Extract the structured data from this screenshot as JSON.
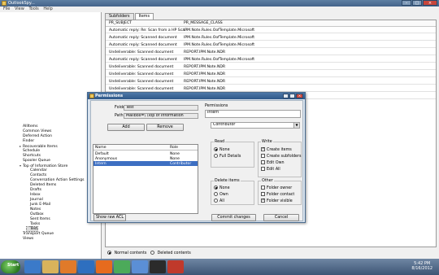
{
  "window": {
    "title": "OutlookSpy...",
    "menu": [
      "File",
      "View",
      "Tools",
      "Help"
    ]
  },
  "tree": {
    "items": [
      {
        "label": "AllItems",
        "indent": 0,
        "expander": "",
        "selected": false
      },
      {
        "label": "Common Views",
        "indent": 0,
        "expander": "",
        "selected": false
      },
      {
        "label": "Deferred Action",
        "indent": 0,
        "expander": "",
        "selected": false
      },
      {
        "label": "Finder",
        "indent": 0,
        "expander": "",
        "selected": false
      },
      {
        "label": "Recoverable Items",
        "indent": 0,
        "expander": "▸",
        "selected": false
      },
      {
        "label": "Schedule",
        "indent": 0,
        "expander": "",
        "selected": false
      },
      {
        "label": "Shortcuts",
        "indent": 0,
        "expander": "",
        "selected": false
      },
      {
        "label": "Spooler Queue",
        "indent": 0,
        "expander": "",
        "selected": false
      },
      {
        "label": "Top of Information Store",
        "indent": 0,
        "expander": "▾",
        "selected": false
      },
      {
        "label": "Calendar",
        "indent": 1,
        "expander": "",
        "selected": false
      },
      {
        "label": "Contacts",
        "indent": 1,
        "expander": "",
        "selected": false
      },
      {
        "label": "Conversation Action Settings",
        "indent": 1,
        "expander": "",
        "selected": false
      },
      {
        "label": "Deleted Items",
        "indent": 1,
        "expander": "",
        "selected": false
      },
      {
        "label": "Drafts",
        "indent": 1,
        "expander": "",
        "selected": false
      },
      {
        "label": "Inbox",
        "indent": 1,
        "expander": "",
        "selected": false
      },
      {
        "label": "Journal",
        "indent": 1,
        "expander": "",
        "selected": false
      },
      {
        "label": "Junk E-Mail",
        "indent": 1,
        "expander": "",
        "selected": false
      },
      {
        "label": "Notes",
        "indent": 1,
        "expander": "",
        "selected": false
      },
      {
        "label": "Outbox",
        "indent": 1,
        "expander": "",
        "selected": false
      },
      {
        "label": "Sent Items",
        "indent": 1,
        "expander": "",
        "selected": false
      },
      {
        "label": "Tasks",
        "indent": 1,
        "expander": "",
        "selected": false
      },
      {
        "label": "Test",
        "indent": 1,
        "expander": "",
        "selected": true
      },
      {
        "label": "Transport Queue",
        "indent": 0,
        "expander": "",
        "selected": false
      },
      {
        "label": "Views",
        "indent": 0,
        "expander": "",
        "selected": false
      }
    ]
  },
  "right": {
    "tabs": [
      {
        "label": "Subfolders",
        "active": false
      },
      {
        "label": "Items",
        "active": true
      }
    ],
    "columns": [
      "PR_SUBJECT",
      "PR_MESSAGE_CLASS"
    ],
    "rows": [
      [
        "Automatic reply: Re: Scan from a HP Sca...",
        "IPM.Note.Rules.OofTemplate.Microsoft"
      ],
      [
        "Automatic reply: Scanned document",
        "IPM.Note.Rules.OofTemplate.Microsoft"
      ],
      [
        "Automatic reply: Scanned document",
        "IPM.Note.Rules.OofTemplate.Microsoft"
      ],
      [
        "Undeliverable: Scanned document",
        "REPORT.IPM.Note.NDR"
      ],
      [
        "Automatic reply: Scanned document",
        "IPM.Note.Rules.OofTemplate.Microsoft"
      ],
      [
        "Undeliverable: Scanned document",
        "REPORT.IPM.Note.NDR"
      ],
      [
        "Undeliverable: Scanned document",
        "REPORT.IPM.Note.NDR"
      ],
      [
        "Undeliverable: Scanned document",
        "REPORT.IPM.Note.NDR"
      ],
      [
        "Undeliverable: Scanned document",
        "REPORT.IPM.Note.NDR"
      ],
      [
        "Undeliverable: Scanned document",
        "REPORT.IPM.Note.NDR"
      ]
    ],
    "contents": {
      "normal": "Normal contents",
      "deleted": "Deleted contents",
      "selected": "normal"
    }
  },
  "dialog": {
    "title": "Permissions",
    "folder_name_label": "Folder name:",
    "folder_name_value": "Test",
    "path_label": "Path:",
    "path_value": "Mailbox=\\                  \\Top of Information",
    "add_label": "Add",
    "remove_label": "Remove",
    "list_columns": [
      "Name",
      "Role"
    ],
    "list_rows": [
      {
        "name": "Default",
        "role": "None",
        "selected": false
      },
      {
        "name": "Anonymous",
        "role": "None",
        "selected": false
      },
      {
        "name": "Intern",
        "role": "Contributor",
        "selected": true
      }
    ],
    "show_raw_acl_label": "Show raw ACL",
    "permissions_label": "Permissions",
    "permissions_user": "Intern",
    "role_value": "Contributor",
    "read": {
      "title": "Read",
      "options": [
        "None",
        "Full Details"
      ],
      "selected": 0
    },
    "write": {
      "title": "Write",
      "options": [
        {
          "label": "Create items",
          "checked": true
        },
        {
          "label": "Create subfolders",
          "checked": false
        },
        {
          "label": "Edit Own",
          "checked": false
        },
        {
          "label": "Edit All",
          "checked": false
        }
      ]
    },
    "delete": {
      "title": "Delete items",
      "options": [
        "None",
        "Own",
        "All"
      ],
      "selected": 0
    },
    "other": {
      "title": "Other",
      "options": [
        {
          "label": "Folder owner",
          "checked": false
        },
        {
          "label": "Folder contact",
          "checked": false
        },
        {
          "label": "Folder visible",
          "checked": true
        }
      ]
    },
    "commit_label": "Commit changes",
    "cancel_label": "Cancel"
  },
  "taskbar": {
    "start_label": "Start",
    "time": "5:42 PM",
    "date": "8/16/2012",
    "icons": [
      "ie-icon",
      "explorer-icon",
      "media-icon",
      "outlook-icon",
      "firefox-icon",
      "chrome-icon",
      "app-icon",
      "terminal-icon",
      "toolbox-icon"
    ]
  }
}
